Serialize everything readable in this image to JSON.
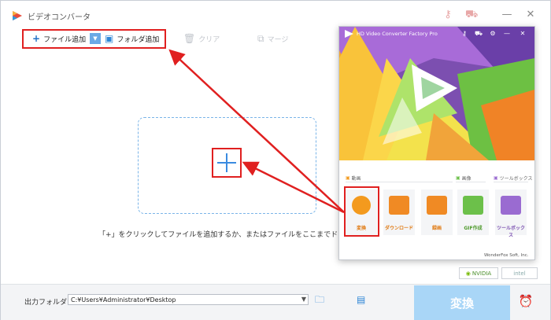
{
  "app": {
    "title": "ビデオコンバータ",
    "titlebar_icons": [
      "key-icon",
      "cart-icon"
    ],
    "window_controls": [
      "minimize-icon",
      "close-icon"
    ]
  },
  "toolbar": {
    "add_file": "ファイル追加",
    "add_folder": "フォルダ追加",
    "clear": "クリア",
    "merge": "マージ"
  },
  "dropzone": {
    "hint": "「+」をクリックしてファイルを追加するか、またはファイルをここまでドラッグし"
  },
  "badges": {
    "nvidia": "NVIDIA",
    "intel": "intel"
  },
  "bottom": {
    "output_label": "出力フォルダ：",
    "output_path": "C:¥Users¥Administrator¥Desktop",
    "convert": "変換"
  },
  "mini_window": {
    "title": "HD Video Converter Factory Pro",
    "sections": {
      "video": "動画",
      "image": "画像",
      "toolbox": "ツールボックス"
    },
    "tiles": [
      {
        "label": "変換",
        "icon": "film-icon",
        "color": "#f39a1e"
      },
      {
        "label": "ダウンロード",
        "icon": "download-icon",
        "color": "#f08a24"
      },
      {
        "label": "録画",
        "icon": "screen-record-icon",
        "color": "#f08a24"
      },
      {
        "label": "GIF作成",
        "icon": "image-icon",
        "color": "#6cc04a"
      },
      {
        "label": "ツールボックス",
        "icon": "toolbox-icon",
        "color": "#9a6bd1"
      }
    ],
    "footer": "WonderFox Soft, Inc."
  },
  "colors": {
    "accent_blue": "#2f86d6",
    "highlight_red": "#e02020",
    "convert_disabled": "#a9d6f7"
  }
}
